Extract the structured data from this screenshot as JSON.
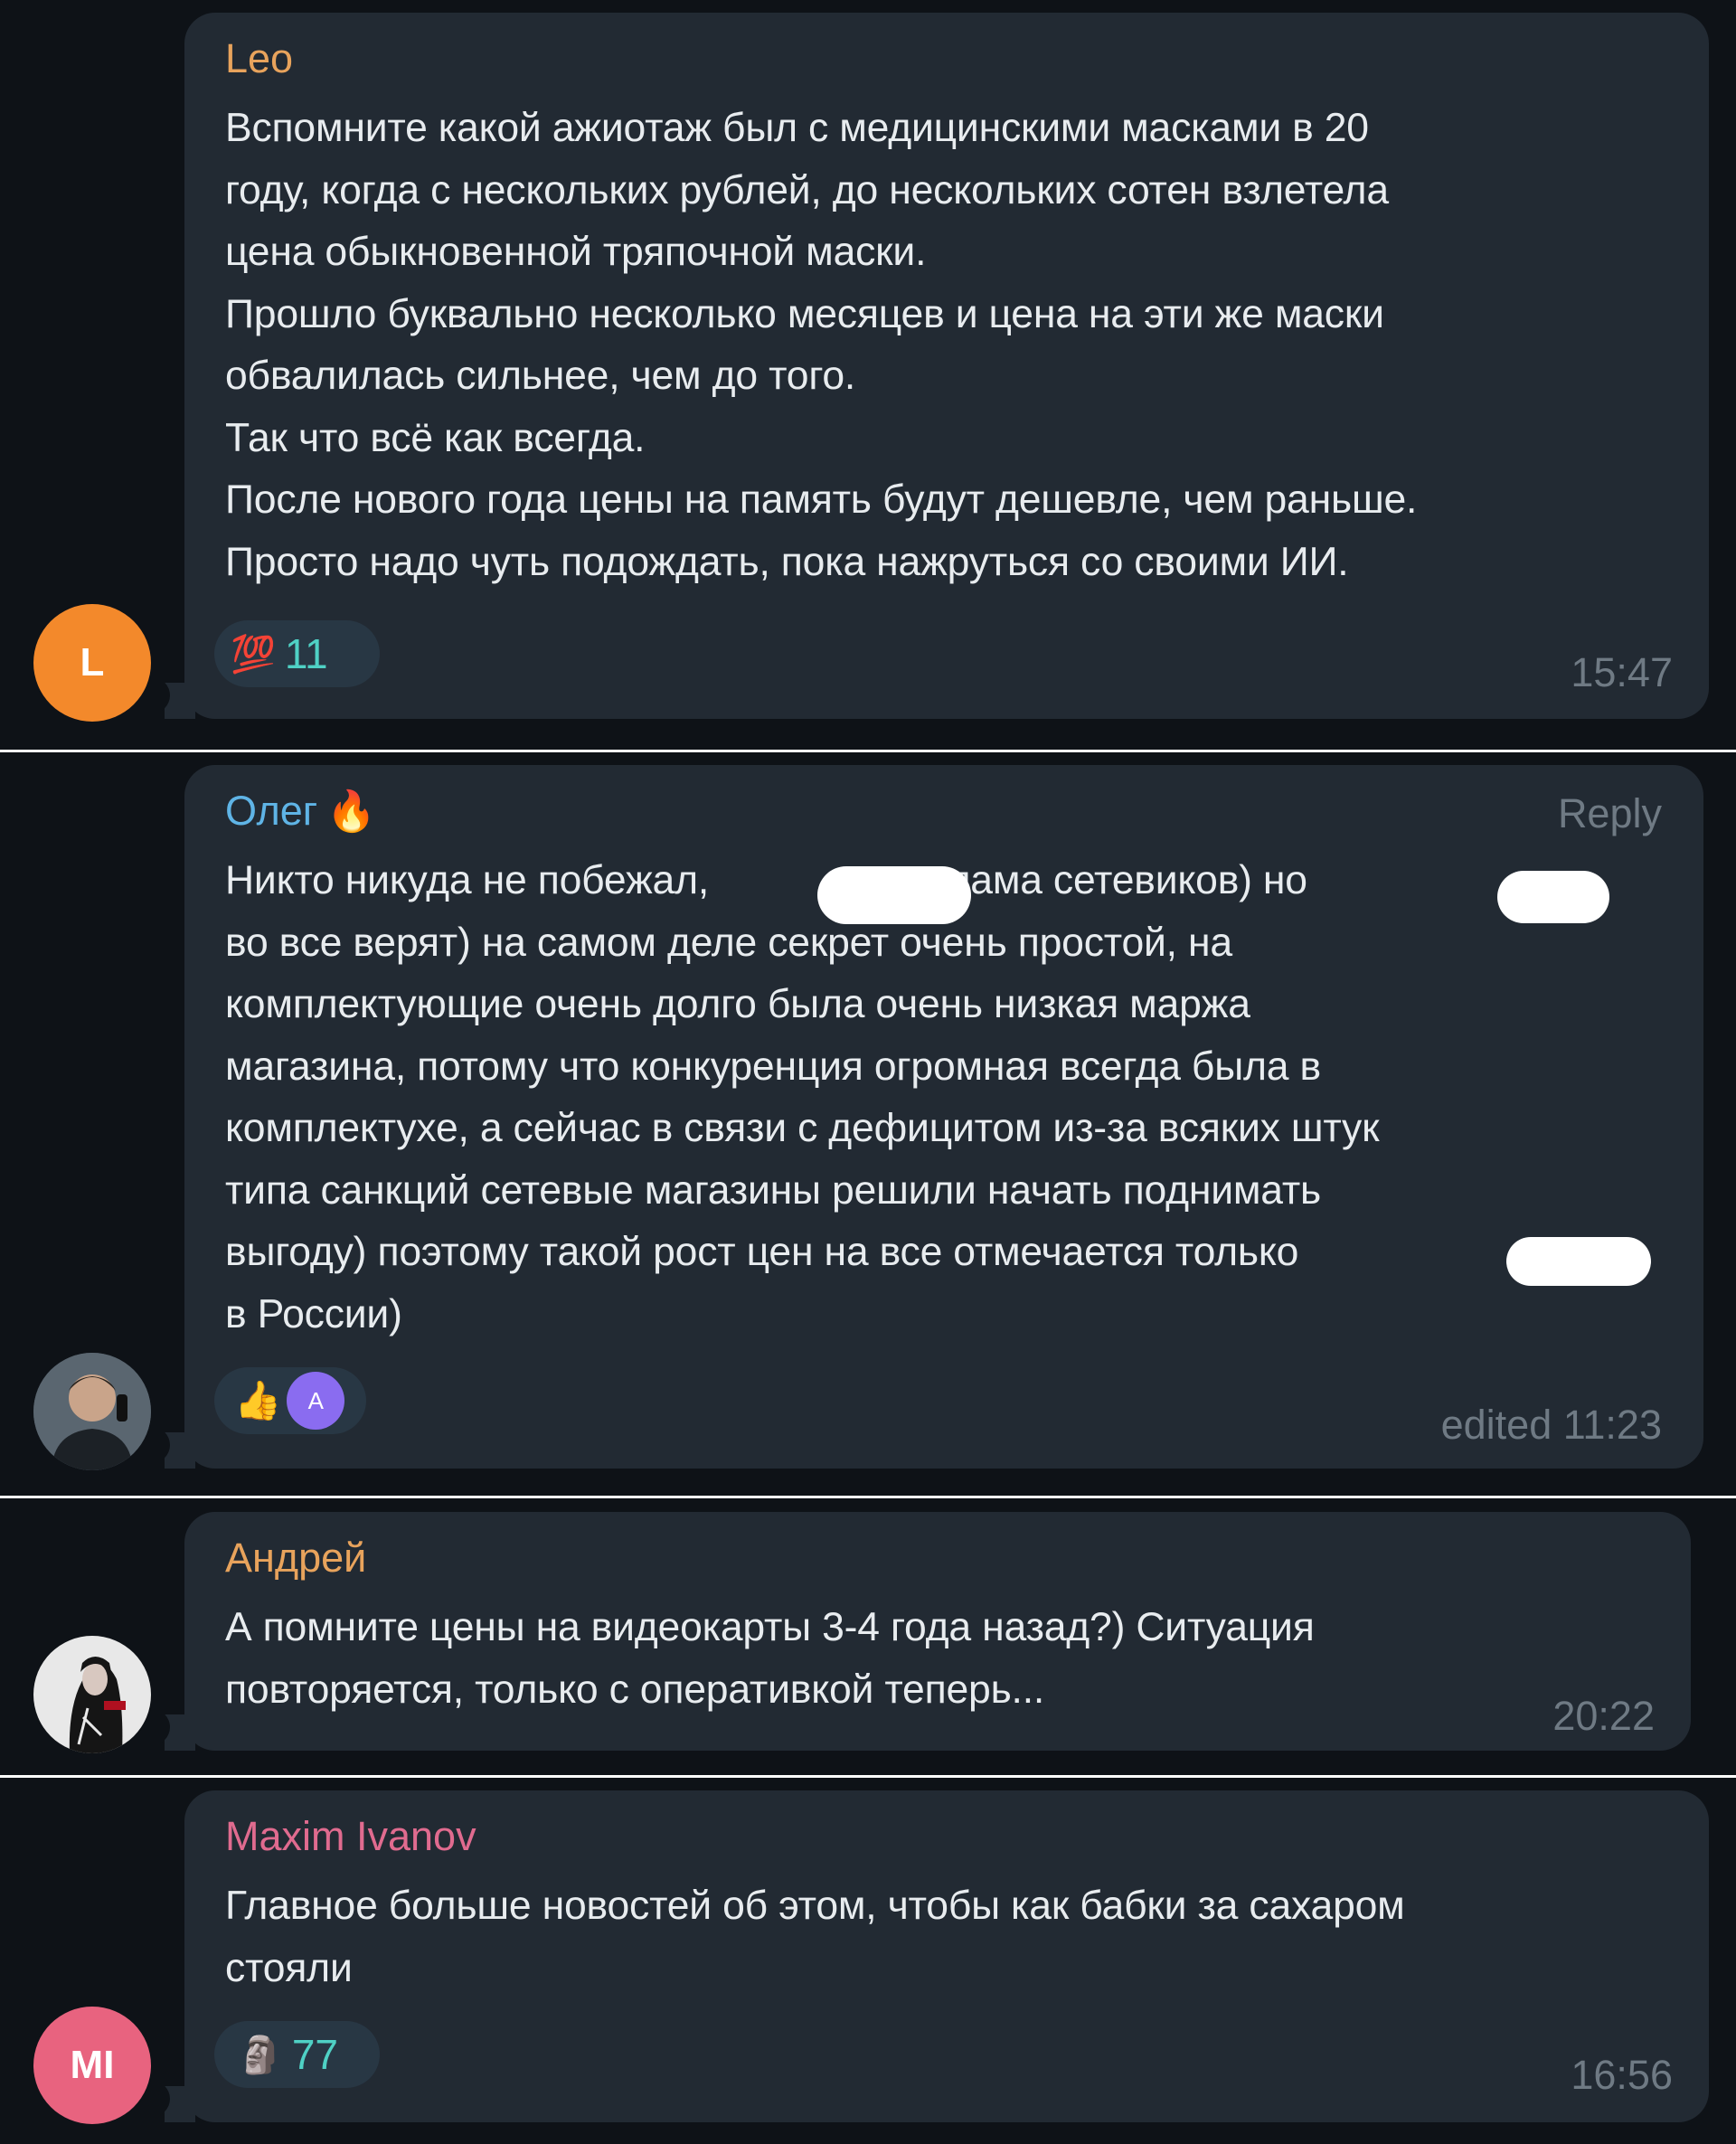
{
  "messages": [
    {
      "sender": "Leo",
      "sender_color": "#e8a35c",
      "avatar_initials": "L",
      "avatar_color": "#f3892b",
      "lines": [
        "Вспомните какой ажиотаж был с медицинскими масками в 20",
        "году, когда с нескольких рублей, до нескольких сотен взлетела",
        "цена обыкновенной тряпочной маски.",
        "Прошло буквально несколько месяцев и цена на эти же маски",
        "обвалилась сильнее, чем до того.",
        "Так что всё как всегда.",
        "После нового года цены на память будут дешевле, чем раньше.",
        "Просто надо чуть подождать, пока нажруться со своими ИИ."
      ],
      "reaction_icon": "hundred-points-icon",
      "reaction_glyph": "💯",
      "reaction_count": "11",
      "time": "15:47"
    },
    {
      "sender": "Олег",
      "sender_color": "#5fb4e6",
      "sender_suffix_glyph": "🔥",
      "reply_label": "Reply",
      "lines": [
        "Никто никуда не побежал,                реклама сетевиков) но",
        "во все верят) на самом деле секрет очень простой, на",
        "комплектующие очень долго была очень низкая маржа",
        "магазина, потому что конкуренция огромная всегда была в",
        "комплектухе, а сейчас в связи с дефицитом из-за всяких штук",
        "типа санкций сетевые магазины решили начать поднимать",
        "выгоду) поэтому такой рост цен на все отмечается только",
        "в России)"
      ],
      "reaction_icon": "thumbs-up-icon",
      "reaction_glyph": "👍",
      "reactor_initial": "A",
      "time": "edited 11:23"
    },
    {
      "sender": "Андрей",
      "sender_color": "#e8a35c",
      "lines": [
        "А помните цены на видеокарты 3-4 года назад?) Ситуация",
        "повторяется, только с оперативкой теперь..."
      ],
      "time": "20:22"
    },
    {
      "sender": "Maxim Ivanov",
      "sender_color": "#e06b8f",
      "avatar_initials": "MI",
      "avatar_color": "#e8637f",
      "lines": [
        "Главное больше новостей об этом, чтобы как бабки за сахаром",
        "стояли"
      ],
      "reaction_icon": "moai-icon",
      "reaction_glyph": "🗿",
      "reaction_count": "77",
      "time": "16:56"
    }
  ]
}
